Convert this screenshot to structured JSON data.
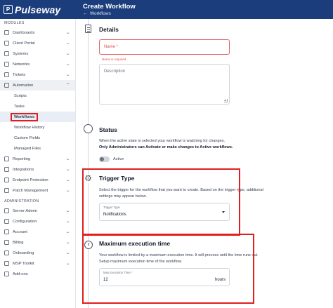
{
  "brand": {
    "name": "Pulseway"
  },
  "header": {
    "title": "Create Workflow",
    "back_label": "Workflows"
  },
  "sidebar": {
    "modules_label": "MODULES",
    "items": [
      {
        "label": "Dashboards"
      },
      {
        "label": "Client Portal"
      },
      {
        "label": "Systems"
      },
      {
        "label": "Networks"
      },
      {
        "label": "Tickets"
      },
      {
        "label": "Automation"
      }
    ],
    "automation_sub": [
      {
        "label": "Scripts"
      },
      {
        "label": "Tasks"
      },
      {
        "label": "Workflows"
      },
      {
        "label": "Workflow History"
      },
      {
        "label": "Custom Fields"
      },
      {
        "label": "Managed Files"
      }
    ],
    "items_after": [
      {
        "label": "Reporting"
      },
      {
        "label": "Integrations"
      },
      {
        "label": "Endpoint Protection"
      },
      {
        "label": "Patch Management"
      }
    ],
    "administration_label": "ADMINISTRATION",
    "admin_items": [
      {
        "label": "Server Admin"
      },
      {
        "label": "Configuration"
      },
      {
        "label": "Account"
      },
      {
        "label": "Billing"
      },
      {
        "label": "Onboarding"
      },
      {
        "label": "MSP Toolkit"
      },
      {
        "label": "Add-ons"
      }
    ]
  },
  "details": {
    "title": "Details",
    "name_placeholder": "Name *",
    "name_error": "Name is required",
    "description_placeholder": "Description"
  },
  "status": {
    "title": "Status",
    "line1": "When the active state is selected your workflow is watching for changes.",
    "line2": "Only Administrators can Activate or make changes to Active workflows.",
    "toggle_label": "Active"
  },
  "trigger": {
    "title": "Trigger Type",
    "line1": "Select the trigger for the workflow that you want to create. Based on the trigger type, additional",
    "line2": "settings may appear below.",
    "field_label": "Trigger Type",
    "field_value": "Notifications"
  },
  "execution": {
    "title": "Maximum execution time",
    "line1": "Your workflow is limited by a maximum execution time. It will process until the time runs out.",
    "line2": "Setup maximum execution time of the workflow.",
    "field_label": "Max Execution Time *",
    "field_value": "12",
    "unit": "hours"
  },
  "colors": {
    "topbar": "#1c3d7c",
    "highlight": "#e01e1e",
    "error": "#e26262"
  }
}
